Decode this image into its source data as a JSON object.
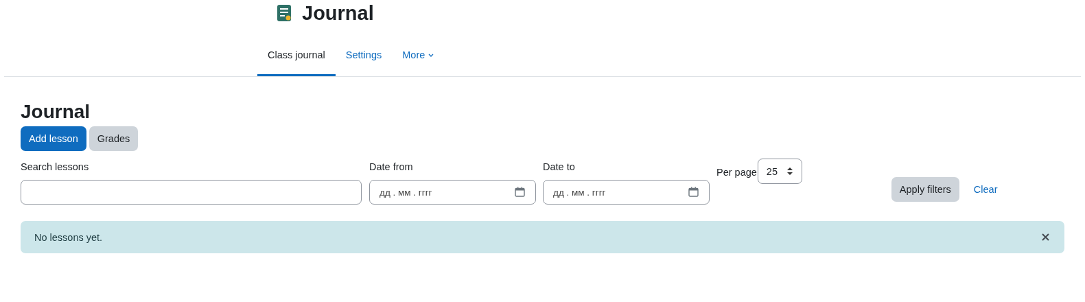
{
  "header": {
    "title": "Journal"
  },
  "tabs": [
    {
      "label": "Class journal",
      "selected": true,
      "dropdown": false
    },
    {
      "label": "Settings",
      "selected": false,
      "dropdown": false
    },
    {
      "label": "More",
      "selected": false,
      "dropdown": true
    }
  ],
  "page": {
    "heading": "Journal"
  },
  "actions": [
    {
      "label": "Add lesson",
      "kind": "primary"
    },
    {
      "label": "Grades",
      "kind": "secondary"
    }
  ],
  "filters": {
    "search": {
      "label": "Search lessons"
    },
    "date_from": {
      "label": "Date from",
      "placeholder": "дд . мм . гггг"
    },
    "date_to": {
      "label": "Date to",
      "placeholder": "дд . мм . гггг"
    },
    "per_page": {
      "label": "Per page",
      "value": "25"
    },
    "apply": "Apply filters",
    "clear": "Clear"
  },
  "alert": {
    "message": "No lessons yet.",
    "dismissible": true
  }
}
